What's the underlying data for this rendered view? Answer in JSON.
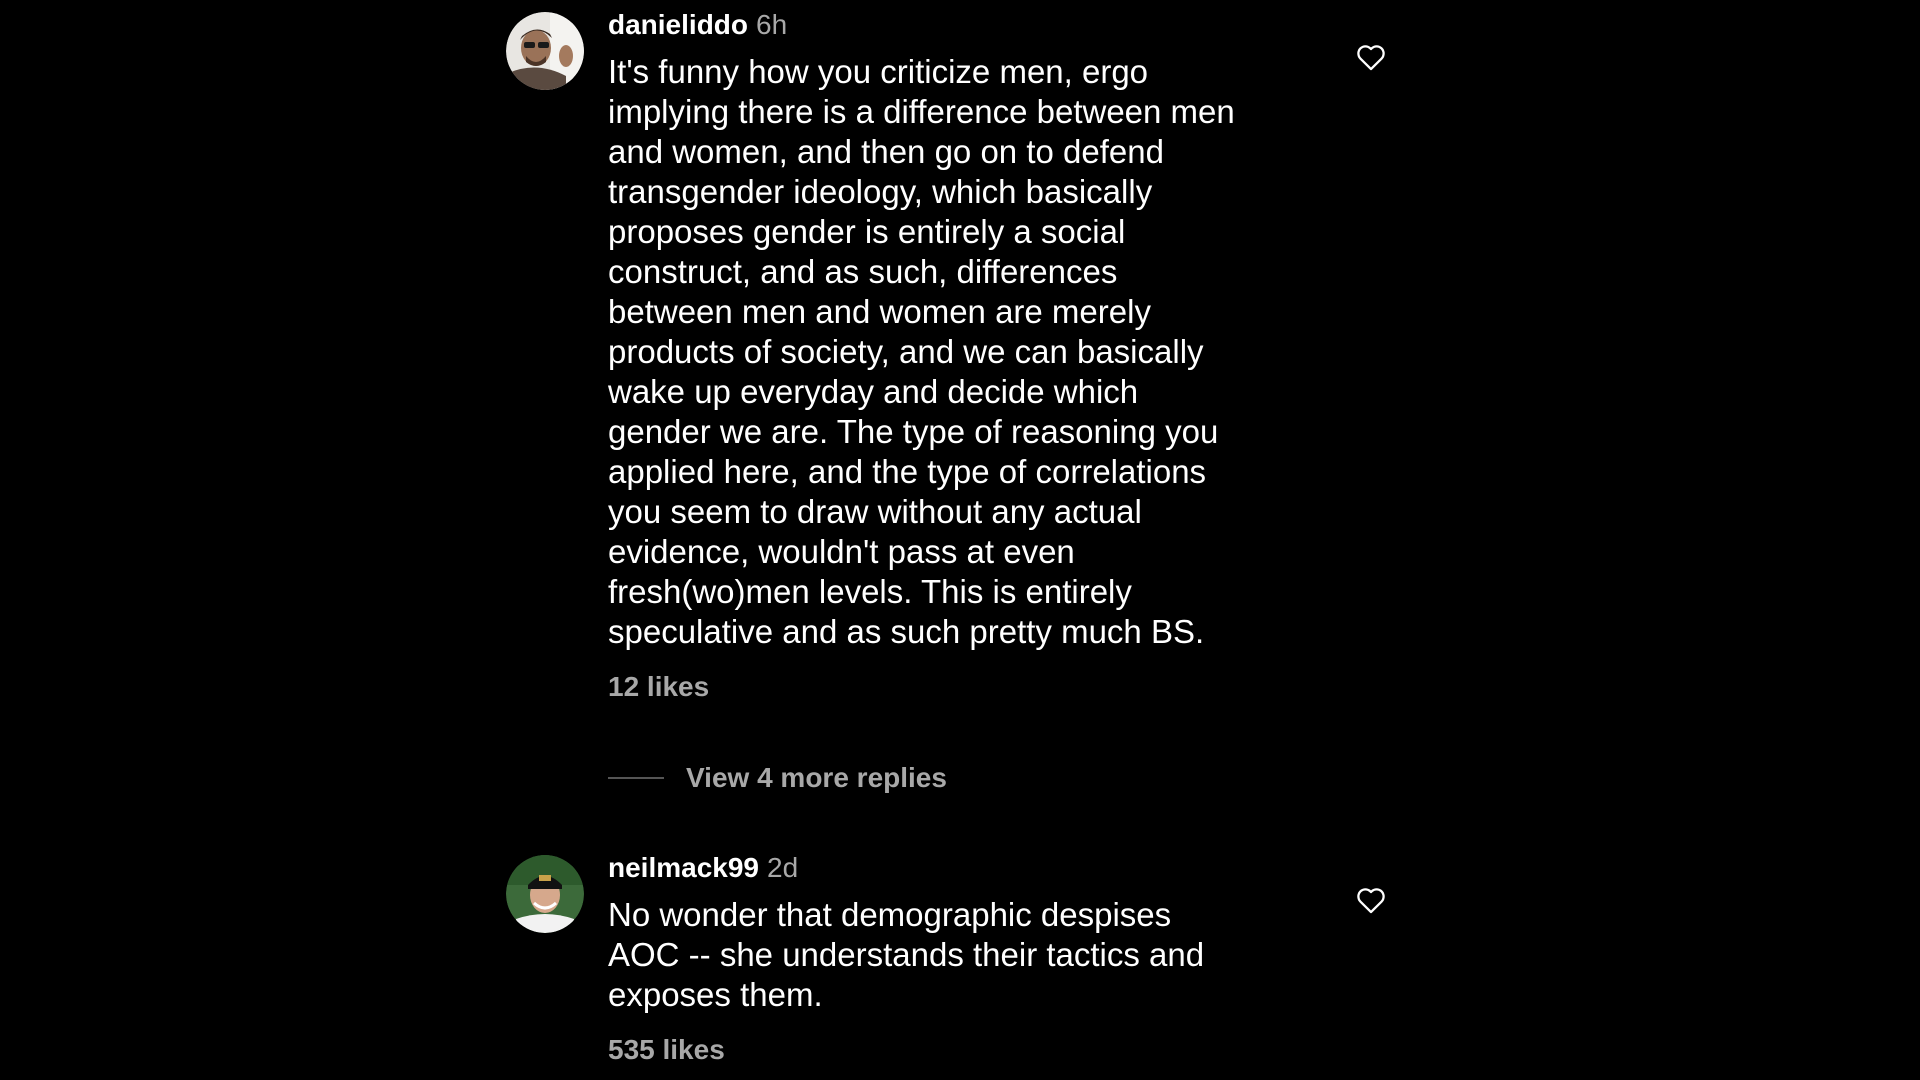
{
  "comments": [
    {
      "username": "danieliddo",
      "time": "6h",
      "text": "It's funny how you criticize men, ergo\nimplying there is a difference between men\nand women, and then go on to defend\ntransgender ideology, which basically\nproposes gender is entirely a social\nconstruct, and as such, differences\nbetween men and women are merely\nproducts of society, and we can basically\nwake up everyday and decide which\ngender we are.  The type of reasoning you\napplied here, and the type of correlations\nyou seem to draw without any actual\nevidence, wouldn't pass at even\nfresh(wo)men levels. This is entirely\nspeculative and as such pretty much BS.",
      "likes": "12 likes",
      "like_icon": "heart-outline-icon"
    },
    {
      "username": "neilmack99",
      "time": "2d",
      "text": "No wonder that demographic despises\nAOC -- she understands their tactics and\nexposes them.",
      "likes": "535 likes",
      "like_icon": "heart-outline-icon"
    }
  ],
  "view_replies": {
    "label": "View 4 more replies"
  },
  "colors": {
    "background": "#000000",
    "primary_text": "#ffffff",
    "secondary_text": "#a8a8a8"
  }
}
